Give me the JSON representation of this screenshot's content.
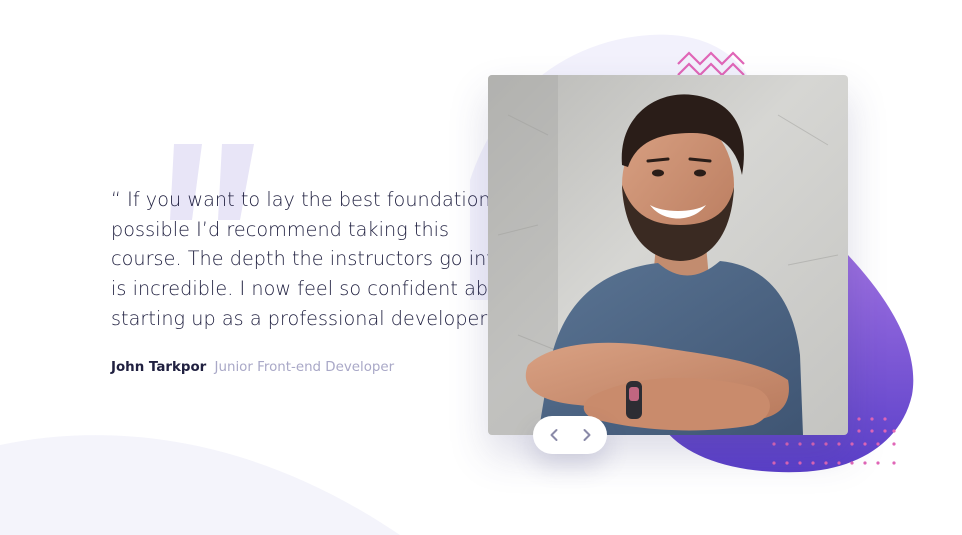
{
  "testimonial": {
    "lines": [
      "“ If you want to lay the best foundation",
      "possible I’d recommend taking this",
      "course. The depth the instructors go into",
      "is incredible. I now feel so confident about",
      "starting up as a professional developer. ”"
    ],
    "author_name": "John Tarkpor",
    "author_role": "Junior Front-end Developer"
  },
  "photo": {
    "subject": "Smiling bearded man in blue t-shirt with arms crossed"
  },
  "navigation": {
    "prev_icon": "chevron-left-icon",
    "next_icon": "chevron-right-icon"
  },
  "colors": {
    "heading_dark": "#202040",
    "muted": "#a9a8c7",
    "quote_mark": "#e6e3f6",
    "gradient_start": "#8a67e0",
    "gradient_end": "#6544c9",
    "pink_accent": "#e066b7",
    "background_curve": "#f5f5fc"
  }
}
